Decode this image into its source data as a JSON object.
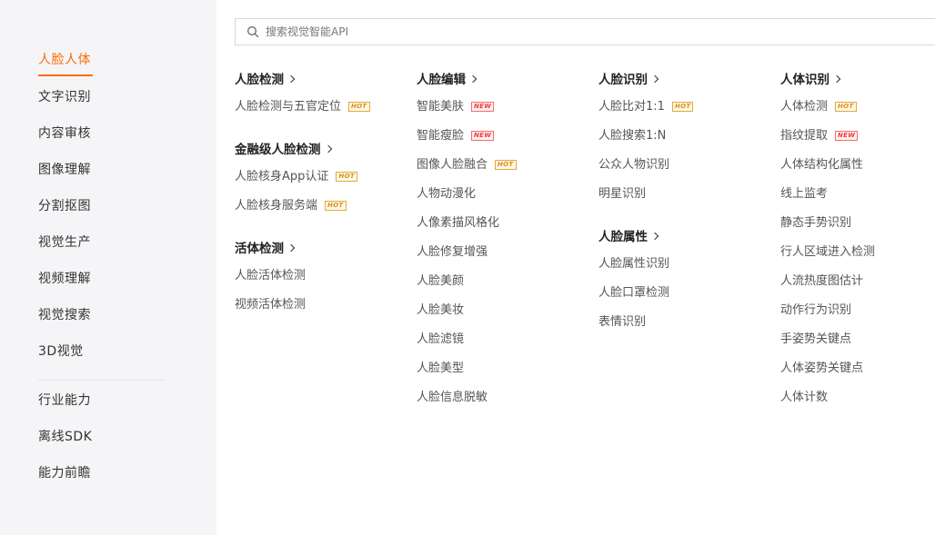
{
  "sidebar": {
    "items": [
      {
        "label": "人脸人体",
        "active": true
      },
      {
        "label": "文字识别"
      },
      {
        "label": "内容审核"
      },
      {
        "label": "图像理解"
      },
      {
        "label": "分割抠图"
      },
      {
        "label": "视觉生产"
      },
      {
        "label": "视频理解"
      },
      {
        "label": "视觉搜索"
      },
      {
        "label": "3D视觉"
      },
      {
        "label": "行业能力"
      },
      {
        "label": "离线SDK"
      },
      {
        "label": "能力前瞻"
      }
    ]
  },
  "search": {
    "placeholder": "搜索视觉智能API",
    "value": ""
  },
  "badges": {
    "hot": "HOT",
    "new": "NEW"
  },
  "columns": [
    {
      "groups": [
        {
          "title": "人脸检测",
          "items": [
            {
              "label": "人脸检测与五官定位",
              "badge": "hot"
            }
          ]
        },
        {
          "title": "金融级人脸检测",
          "items": [
            {
              "label": "人脸核身App认证",
              "badge": "hot"
            },
            {
              "label": "人脸核身服务端",
              "badge": "hot"
            }
          ]
        },
        {
          "title": "活体检测",
          "items": [
            {
              "label": "人脸活体检测"
            },
            {
              "label": "视频活体检测"
            }
          ]
        }
      ]
    },
    {
      "groups": [
        {
          "title": "人脸编辑",
          "items": [
            {
              "label": "智能美肤",
              "badge": "new"
            },
            {
              "label": "智能瘦脸",
              "badge": "new"
            },
            {
              "label": "图像人脸融合",
              "badge": "hot"
            },
            {
              "label": "人物动漫化"
            },
            {
              "label": "人像素描风格化"
            },
            {
              "label": "人脸修复增强"
            },
            {
              "label": "人脸美颜"
            },
            {
              "label": "人脸美妆"
            },
            {
              "label": "人脸滤镜"
            },
            {
              "label": "人脸美型"
            },
            {
              "label": "人脸信息脱敏"
            }
          ]
        }
      ]
    },
    {
      "groups": [
        {
          "title": "人脸识别",
          "items": [
            {
              "label": "人脸比对1:1",
              "badge": "hot"
            },
            {
              "label": "人脸搜索1:N"
            },
            {
              "label": "公众人物识别"
            },
            {
              "label": "明星识别"
            }
          ]
        },
        {
          "title": "人脸属性",
          "items": [
            {
              "label": "人脸属性识别"
            },
            {
              "label": "人脸口罩检测"
            },
            {
              "label": "表情识别"
            }
          ]
        }
      ]
    },
    {
      "groups": [
        {
          "title": "人体识别",
          "items": [
            {
              "label": "人体检测",
              "badge": "hot"
            },
            {
              "label": "指纹提取",
              "badge": "new"
            },
            {
              "label": "人体结构化属性"
            },
            {
              "label": "线上监考"
            },
            {
              "label": "静态手势识别"
            },
            {
              "label": "行人区域进入检测"
            },
            {
              "label": "人流热度图估计"
            },
            {
              "label": "动作行为识别"
            },
            {
              "label": "手姿势关键点"
            },
            {
              "label": "人体姿势关键点"
            },
            {
              "label": "人体计数"
            }
          ]
        }
      ]
    }
  ]
}
